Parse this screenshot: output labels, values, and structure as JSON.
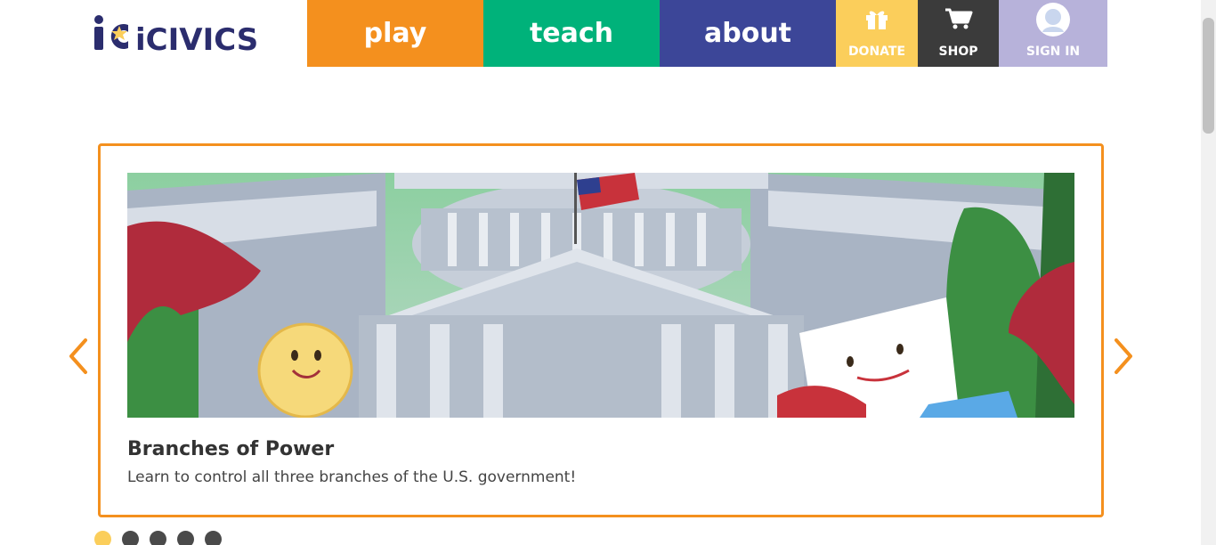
{
  "logo": {
    "text": "iCIVICS"
  },
  "nav": {
    "play_label": "play",
    "teach_label": "teach",
    "about_label": "about",
    "donate_label": "DONATE",
    "shop_label": "SHOP",
    "signin_label": "SIGN IN"
  },
  "icons": {
    "donate": "gift-icon",
    "shop": "cart-icon",
    "signin": "avatar-icon",
    "prev": "chevron-left-icon",
    "next": "chevron-right-icon"
  },
  "colors": {
    "play": "#f4901e",
    "teach": "#00b27a",
    "about": "#3c4698",
    "donate": "#fbce5b",
    "shop": "#3b3b3b",
    "signin": "#b7b2da",
    "carousel_border": "#f4901e",
    "logo": "#2b2d6e"
  },
  "carousel": {
    "slide": {
      "title": "Branches of Power",
      "description": "Learn to control all three branches of the U.S. government!"
    },
    "total_slides": 5,
    "active_slide": 1
  }
}
